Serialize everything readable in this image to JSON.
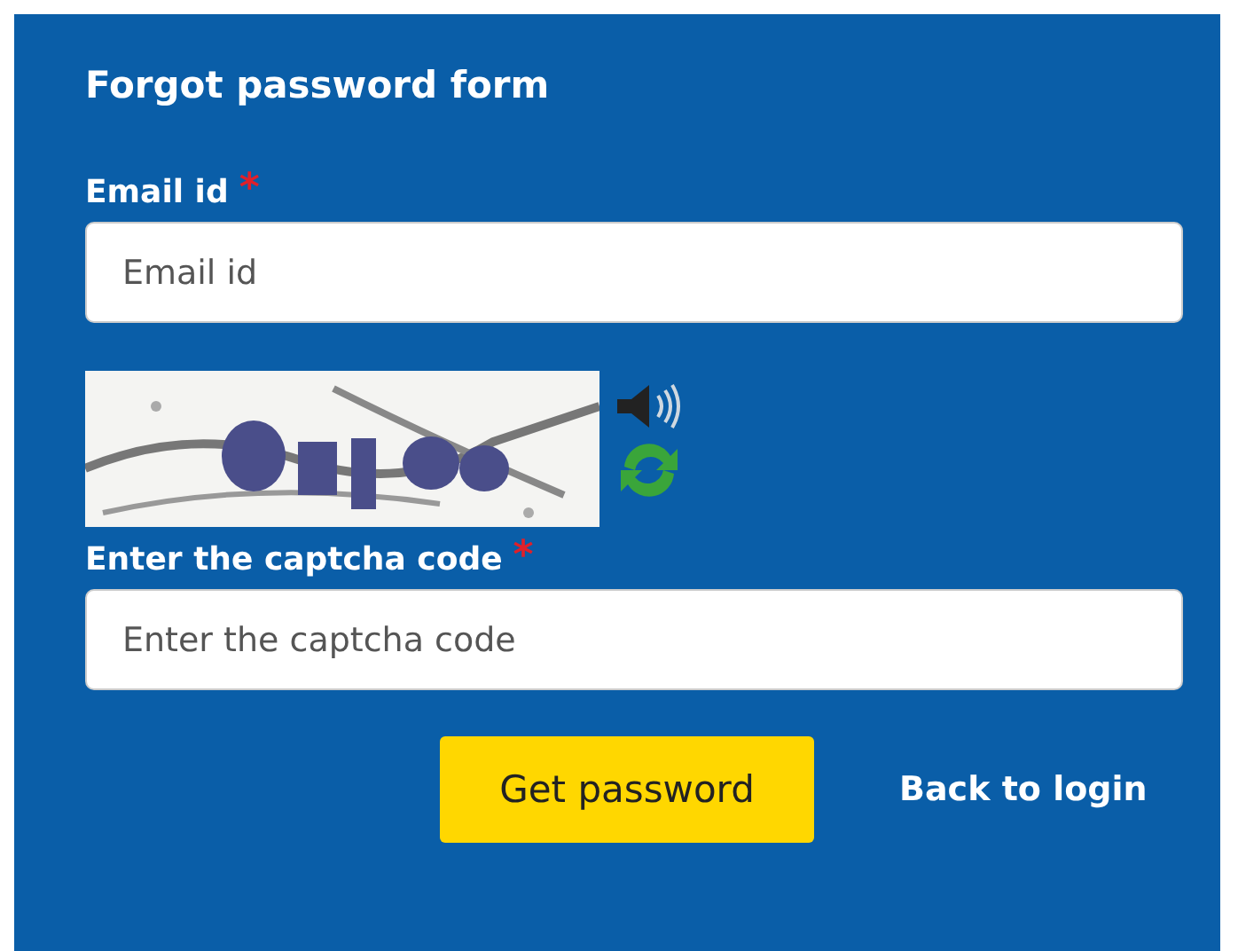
{
  "form": {
    "title": "Forgot password form",
    "email": {
      "label": "Email id",
      "required_mark": "*",
      "placeholder": "Email id"
    },
    "captcha_field": {
      "label": "Enter the captcha code",
      "required_mark": "*",
      "placeholder": "Enter the captcha code"
    },
    "submit": "Get password",
    "back_link": "Back to login"
  }
}
